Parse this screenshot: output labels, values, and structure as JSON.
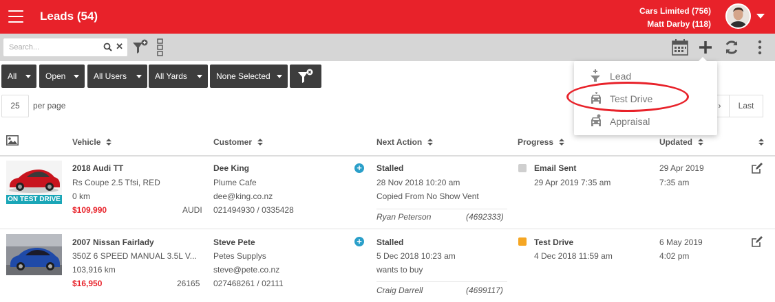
{
  "header": {
    "title": "Leads (54)",
    "company": "Cars Limited (756)",
    "user": "Matt Darby (118)"
  },
  "toolbar": {
    "search_placeholder": "Search..."
  },
  "filters": [
    {
      "label": "All"
    },
    {
      "label": "Open"
    },
    {
      "label": "All Users"
    },
    {
      "label": "All Yards"
    },
    {
      "label": "None Selected"
    }
  ],
  "pagination": {
    "per_page_value": "25",
    "per_page_label": "per page",
    "next": "›",
    "last": "Last"
  },
  "table": {
    "columns": {
      "vehicle": "Vehicle",
      "customer": "Customer",
      "next_action": "Next Action",
      "progress": "Progress",
      "updated": "Updated"
    },
    "rows": [
      {
        "badge": "ON TEST DRIVE",
        "vehicle_title": "2018 Audi TT",
        "vehicle_desc": "Rs Coupe 2.5 Tfsi, RED",
        "vehicle_km": "0 km",
        "price": "$109,990",
        "stock": "AUDI",
        "customer_name": "Dee King",
        "customer_company": "Plume Cafe",
        "customer_email": "dee@king.co.nz",
        "customer_phone": "021494930 / 0335428",
        "action_status": "Stalled",
        "action_date": "28 Nov 2018 10:20 am",
        "action_note": "Copied From No Show Vent",
        "action_user": "Ryan Peterson",
        "action_ref": "(4692333)",
        "progress_label": "Email Sent",
        "progress_date": "29 Apr 2019 7:35 am",
        "progress_color": "#cfcfcf",
        "updated_date": "29 Apr 2019",
        "updated_time": "7:35 am"
      },
      {
        "badge": "",
        "vehicle_title": "2007 Nissan Fairlady",
        "vehicle_desc": "350Z 6 SPEED MANUAL 3.5L V...",
        "vehicle_km": "103,916 km",
        "price": "$16,950",
        "stock": "26165",
        "customer_name": "Steve Pete",
        "customer_company": "Petes Supplys",
        "customer_email": "steve@pete.co.nz",
        "customer_phone": "027468261 / 02111",
        "action_status": "Stalled",
        "action_date": "5 Dec 2018 10:23 am",
        "action_note": "wants to buy",
        "action_user": "Craig Darrell",
        "action_ref": "(4699117)",
        "progress_label": "Test Drive",
        "progress_date": "4 Dec 2018 11:59 am",
        "progress_color": "#f5a623",
        "updated_date": "6 May 2019",
        "updated_time": "4:02 pm"
      }
    ]
  },
  "add_menu": {
    "items": [
      {
        "label": "Lead",
        "icon": "lead-icon"
      },
      {
        "label": "Test Drive",
        "icon": "car-icon"
      },
      {
        "label": "Appraisal",
        "icon": "car-icon"
      }
    ]
  },
  "colors": {
    "brand": "#e8222a",
    "toolbar": "#d6d6d6",
    "filter_button": "#3d3d3d",
    "accent": "#1aa6b7"
  }
}
